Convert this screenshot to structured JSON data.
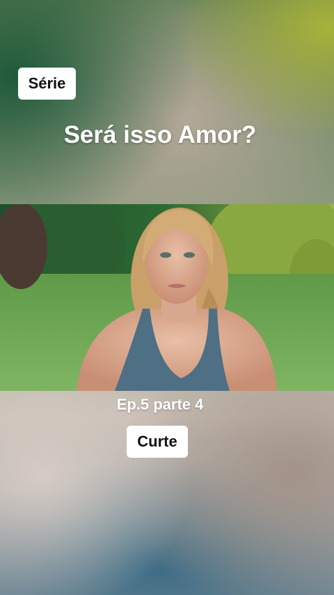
{
  "badge": {
    "label": "Série"
  },
  "title": "Será isso Amor?",
  "video": {
    "subject": "woman-in-park"
  },
  "episode": "Ep.5 parte 4",
  "action": {
    "label": "Curte"
  },
  "colors": {
    "badge_bg": "#ffffff",
    "text": "#ffffff"
  }
}
